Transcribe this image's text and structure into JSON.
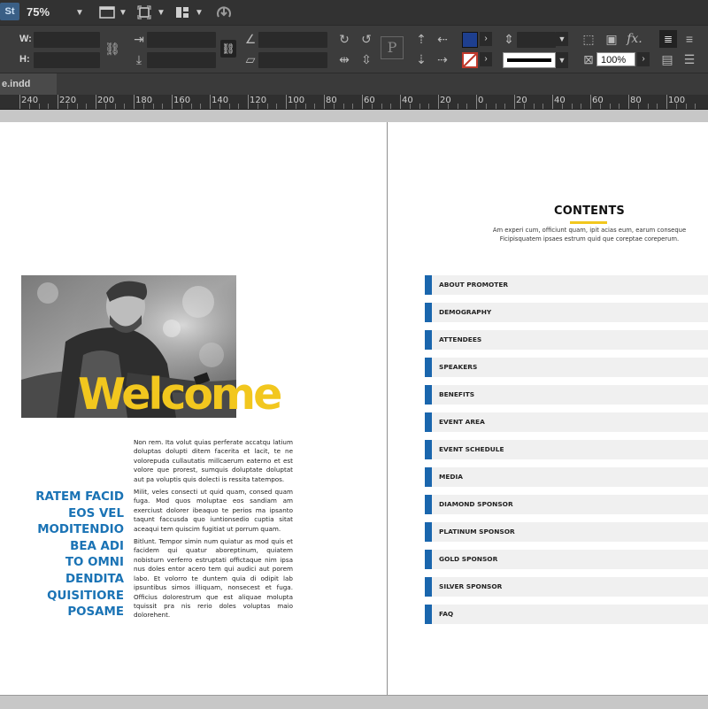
{
  "app": {
    "logo_text": "St",
    "zoom": "75%",
    "tab_name": "e.indd"
  },
  "control_panel": {
    "w_label": "W:",
    "h_label": "H:",
    "scale_value": "100%",
    "fill_color": "#1e3f8f",
    "stroke_color": "#c0392b"
  },
  "ruler": {
    "labels": [
      "240",
      "220",
      "200",
      "180",
      "160",
      "140",
      "120",
      "100",
      "80",
      "60",
      "40",
      "20",
      "0",
      "20",
      "40",
      "60",
      "80",
      "100"
    ]
  },
  "left_page": {
    "welcome": "Welcome",
    "headline": [
      "RATEM FACID",
      "EOS VEL",
      "MODITENDIO",
      "BEA ADI",
      "TO OMNI",
      "DENDITA",
      "QUISITIORE",
      "POSAME"
    ],
    "paragraphs": [
      "Non rem. Ita volut quias perferate accatqu latium doluptas dolupti ditem facerita et lacit, te ne volorepuda cullautatis millcaerum eaterno et est volore que prorest, sumquis doluptate doluptat aut pa voluptis quis dolecti is ressita tatempos.",
      "Milit, veles consecti ut quid quam, consed quam fuga. Mod quos moluptae eos sandiam am exerciust dolorer ibeaquo te perios ma ipsanto taqunt faccusda quo iuntionsedio cuptia sitat aceaqui tem quiscim fugitiat ut porrum quam.",
      "Bitlunt. Tempor simin num quiatur as mod quis et facidem qui quatur aboreptinum, quiatem nobisturn verferro estruptati offictaque nim ipsa nus doles entor acero tem qui audici aut porem labo. Et volorro te duntem quia di odipit lab ipsuntibus simos illiquam, nonsecest et fuga. Officius dolorestrum que est aliquae molupta tquissit pra nis rerio doles voluptas maio dolorehent."
    ]
  },
  "right_page": {
    "title": "CONTENTS",
    "subtitle_lines": [
      "Am experi cum, officiunt quam, ipit acias eum, earum conseque",
      "Ficipisquatem ipsaes estrum quid que coreptae coreperum."
    ],
    "items": [
      "ABOUT PROMOTER",
      "DEMOGRAPHY",
      "ATTENDEES",
      "SPEAKERS",
      "BENEFITS",
      "EVENT AREA",
      "EVENT SCHEDULE",
      "MEDIA",
      "DIAMOND SPONSOR",
      "PLATINUM SPONSOR",
      "GOLD SPONSOR",
      "SILVER SPONSOR",
      "FAQ"
    ]
  },
  "colors": {
    "accent_yellow": "#f2c71e",
    "accent_blue": "#1a66ad",
    "headline_blue": "#1a73b5"
  }
}
